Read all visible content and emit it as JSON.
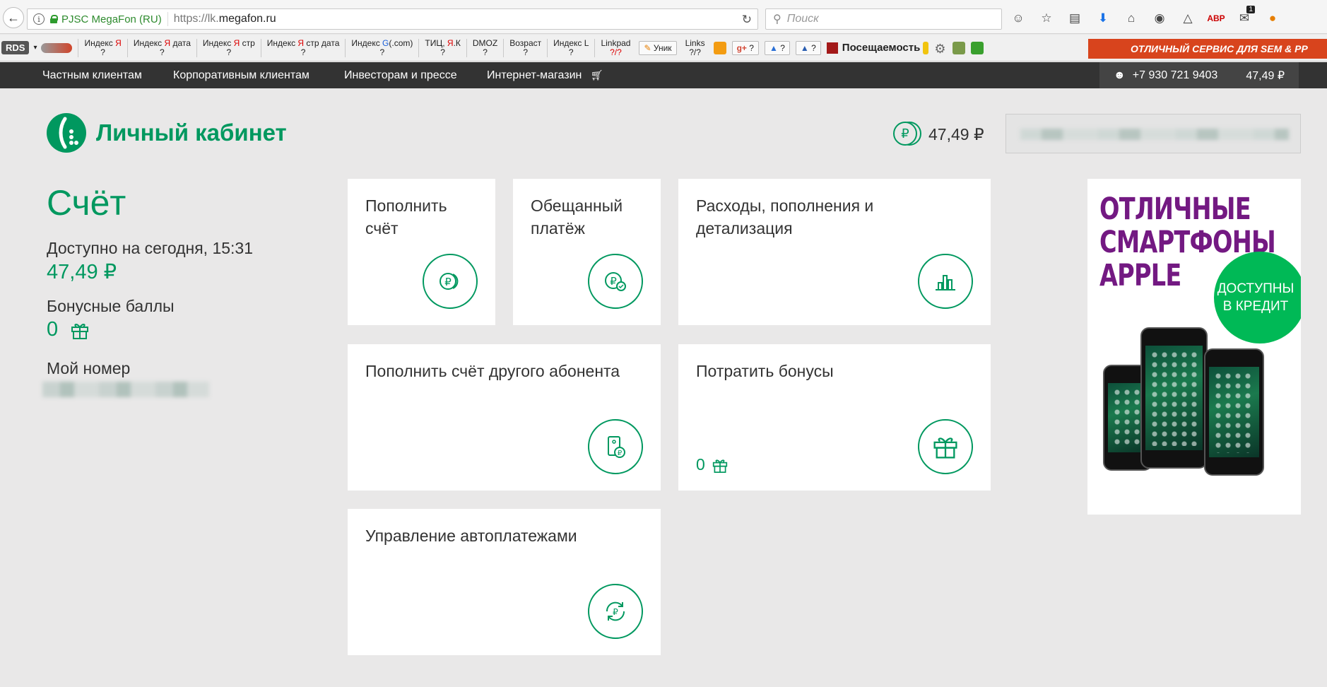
{
  "browser": {
    "site_identity": "PJSC MegaFon (RU)",
    "url_prefix": "https://lk.",
    "url_host": "megafon.ru",
    "search_placeholder": "Поиск",
    "notifications_badge": "1"
  },
  "bookmarks": {
    "rds": "RDS",
    "items": [
      {
        "top": "Индекс Я",
        "bottom": "?"
      },
      {
        "top": "Индекс Я дата",
        "bottom": "?"
      },
      {
        "top": "Индекс Я стр",
        "bottom": "?"
      },
      {
        "top": "Индекс Я стр дата",
        "bottom": "?"
      },
      {
        "top": "Индекс G(.com)",
        "bottom": "?"
      },
      {
        "top": "ТИЦ, Я.К",
        "bottom": "?"
      },
      {
        "top": "DMOZ",
        "bottom": "?"
      },
      {
        "top": "Возраст",
        "bottom": "?"
      },
      {
        "top": "Индекс L",
        "bottom": "?"
      },
      {
        "top": "Linkpad",
        "bottom": "?/?"
      }
    ],
    "unik": "Уник",
    "links": "Links",
    "links_bottom": "?/?",
    "q1": "?",
    "q2": "?",
    "q3": "?",
    "visits": "Посещаемость",
    "banner": "ОТЛИЧНЫЙ СЕРВИС ДЛЯ SEM & PP"
  },
  "nav": {
    "items": [
      "Частным клиентам",
      "Корпоративным клиентам",
      "Инвесторам и прессе",
      "Интернет-магазин"
    ],
    "phone": "+7 930 721 9403",
    "balance": "47,49 ₽"
  },
  "header": {
    "logo_text": "Личный кабинет",
    "balance": "47,49 ₽"
  },
  "account": {
    "title": "Счёт",
    "available_label": "Доступно на сегодня, 15:31",
    "available_value": "47,49 ₽",
    "bonus_label": "Бонусные баллы",
    "bonus_value": "0",
    "my_number_label": "Мой номер"
  },
  "tiles": {
    "top_up": "Пополнить счёт",
    "promised": "Обещанный платёж",
    "expenses": "Расходы, пополнения и детализация",
    "top_up_other": "Пополнить счёт другого абонента",
    "spend_bonus": "Потратить бонусы",
    "spend_bonus_count": "0",
    "autopay": "Управление автоплатежами"
  },
  "ad": {
    "title": "ОТЛИЧНЫЕ СМАРТФОНЫ APPLE",
    "badge": "ДОСТУПНЫ В КРЕДИТ"
  },
  "colors": {
    "brand_green": "#00985f",
    "ad_purple": "#731982",
    "ad_badge_green": "#00b956"
  }
}
